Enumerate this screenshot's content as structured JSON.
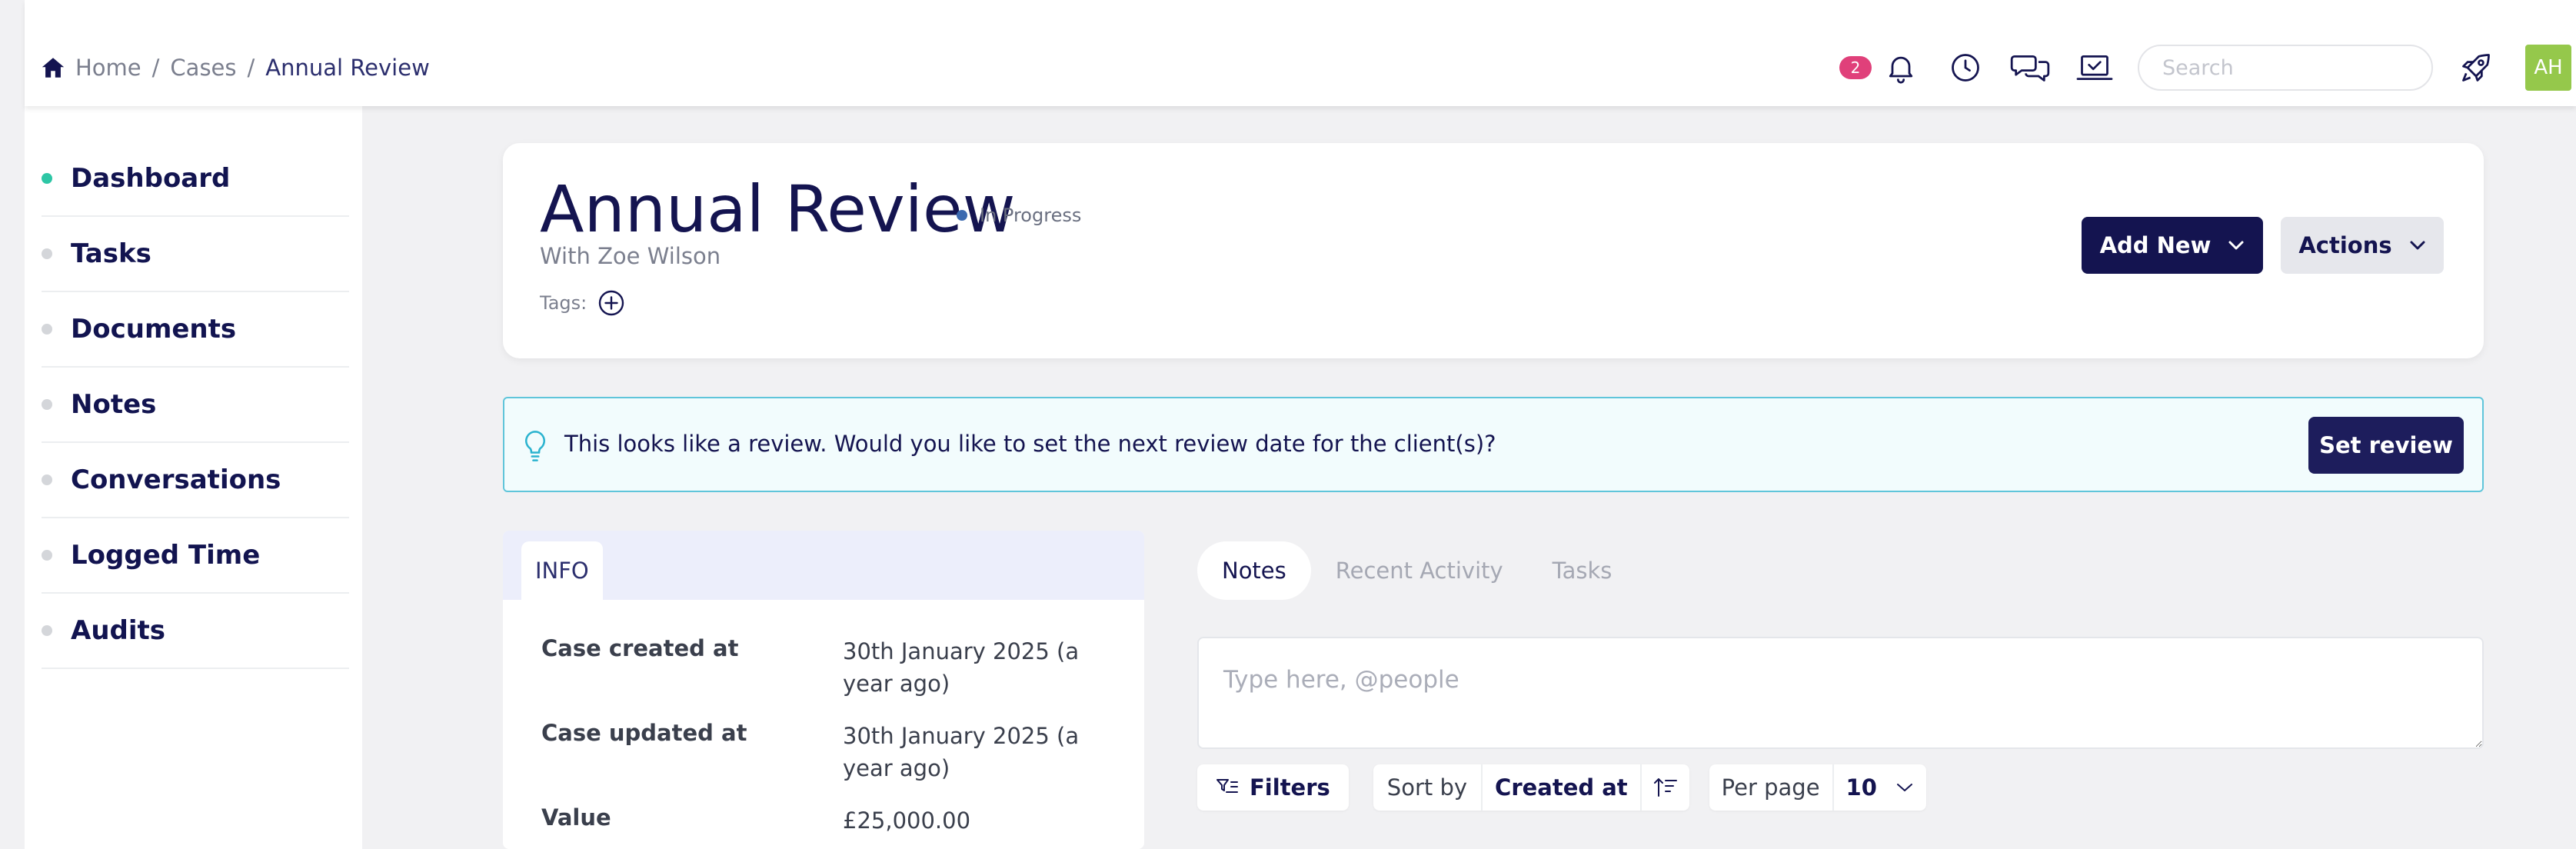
{
  "breadcrumb": {
    "home": "Home",
    "cases": "Cases",
    "current": "Annual Review",
    "separator": "/"
  },
  "topbar": {
    "notification_count": "2",
    "search_placeholder": "Search",
    "avatar_initials": "AH"
  },
  "sidebar": {
    "items": [
      {
        "label": "Dashboard",
        "active": true
      },
      {
        "label": "Tasks"
      },
      {
        "label": "Documents"
      },
      {
        "label": "Notes"
      },
      {
        "label": "Conversations"
      },
      {
        "label": "Logged Time"
      },
      {
        "label": "Audits"
      }
    ]
  },
  "case": {
    "title": "Annual Review",
    "status": "In Progress",
    "subtitle": "With Zoe Wilson",
    "tags_label": "Tags:",
    "add_new_label": "Add New",
    "actions_label": "Actions"
  },
  "banner": {
    "message": "This looks like a review. Would you like to set the next review date for the client(s)?",
    "button_label": "Set review"
  },
  "info": {
    "tab_label": "INFO",
    "rows": [
      {
        "key": "Case created at",
        "value": "30th January 2025 (a year ago)"
      },
      {
        "key": "Case updated at",
        "value": "30th January 2025 (a year ago)"
      },
      {
        "key": "Value",
        "value": "£25,000.00"
      }
    ]
  },
  "activity": {
    "tabs": [
      "Notes",
      "Recent Activity",
      "Tasks"
    ],
    "note_placeholder": "Type here, @people",
    "filters_label": "Filters",
    "sort_label": "Sort by",
    "sort_value": "Created at",
    "per_page_label": "Per page",
    "per_page_value": "10"
  },
  "colors": {
    "brand_navy": "#141450",
    "accent_green": "#2dc6a5",
    "badge_pink": "#e0407a",
    "avatar_green": "#95c84b",
    "banner_border": "#60c5da"
  }
}
